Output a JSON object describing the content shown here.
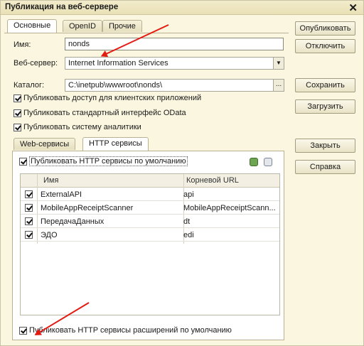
{
  "window": {
    "title": "Публикация на веб-сервере",
    "close": "✕"
  },
  "tabs": [
    "Основные",
    "OpenID",
    "Прочие"
  ],
  "fields": {
    "name_label": "Имя:",
    "name_value": "nonds",
    "webserver_label": "Веб-сервер:",
    "webserver_value": "Internet Information Services",
    "catalog_label": "Каталог:",
    "catalog_value": "C:\\inetpub\\wwwroot\\nonds\\",
    "catalog_button": "..."
  },
  "options": [
    "Публиковать доступ для клиентских приложений",
    "Публиковать стандартный интерфейс OData",
    "Публиковать систему аналитики"
  ],
  "subtabs": [
    "Web-сервисы",
    "HTTP сервисы"
  ],
  "http": {
    "publish_default": "Публиковать HTTP сервисы по умолчанию",
    "columns": [
      "Имя",
      "Корневой URL"
    ],
    "rows": [
      {
        "name": "ExternalAPI",
        "url": "api"
      },
      {
        "name": "MobileAppReceiptScanner",
        "url": "MobileAppReceiptScann..."
      },
      {
        "name": "ПередачаДанных",
        "url": "dt"
      },
      {
        "name": "ЭДО",
        "url": "edi"
      }
    ],
    "publish_extensions": "Публиковать HTTP сервисы расширений по умолчанию"
  },
  "buttons": {
    "publish": "Опубликовать",
    "disable": "Отключить",
    "save": "Сохранить",
    "load": "Загрузить",
    "close": "Закрыть",
    "help": "Справка"
  },
  "colors": {
    "window_bg": "#fbf6df",
    "annotation_arrow": "#e41b13"
  }
}
